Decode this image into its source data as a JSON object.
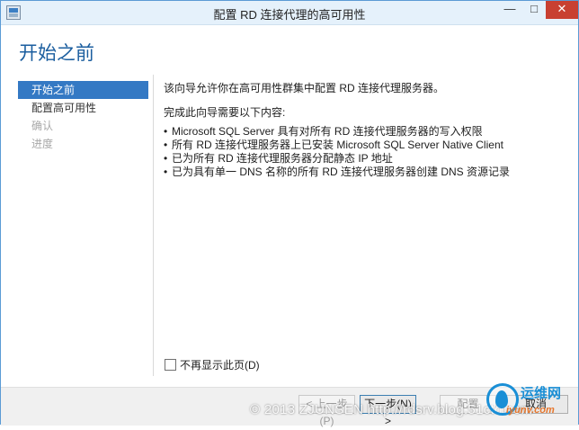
{
  "window": {
    "title": "配置 RD 连接代理的高可用性",
    "min_glyph": "—",
    "max_glyph": "□",
    "close_glyph": "✕"
  },
  "page": {
    "title": "开始之前"
  },
  "nav": {
    "items": [
      {
        "label": "开始之前",
        "state": "active"
      },
      {
        "label": "配置高可用性",
        "state": "enabled"
      },
      {
        "label": "确认",
        "state": "disabled"
      },
      {
        "label": "进度",
        "state": "disabled"
      }
    ]
  },
  "content": {
    "intro": "该向导允许你在高可用性群集中配置 RD 连接代理服务器。",
    "lead": "完成此向导需要以下内容:",
    "requirements": [
      "Microsoft SQL Server 具有对所有 RD 连接代理服务器的写入权限",
      "所有 RD 连接代理服务器上已安装 Microsoft SQL Server Native Client",
      "已为所有 RD 连接代理服务器分配静态 IP 地址",
      "已为具有单一 DNS 名称的所有 RD 连接代理服务器创建 DNS 资源记录"
    ]
  },
  "skip": {
    "label": "不再显示此页(D)",
    "checked": false
  },
  "footer": {
    "prev_label": "< 上一步(P)",
    "next_label": "下一步(N) >",
    "install_label": "配置",
    "cancel_label": "取消"
  },
  "watermark": {
    "text": "© 2013 ZJUNSEN http://rdsrv.blog.51cto.com",
    "logo_name": "运维网",
    "logo_site": "iyunv.com"
  },
  "colors": {
    "accent": "#3479c4",
    "title_blue": "#1b5e9f",
    "close_red": "#c84031"
  }
}
